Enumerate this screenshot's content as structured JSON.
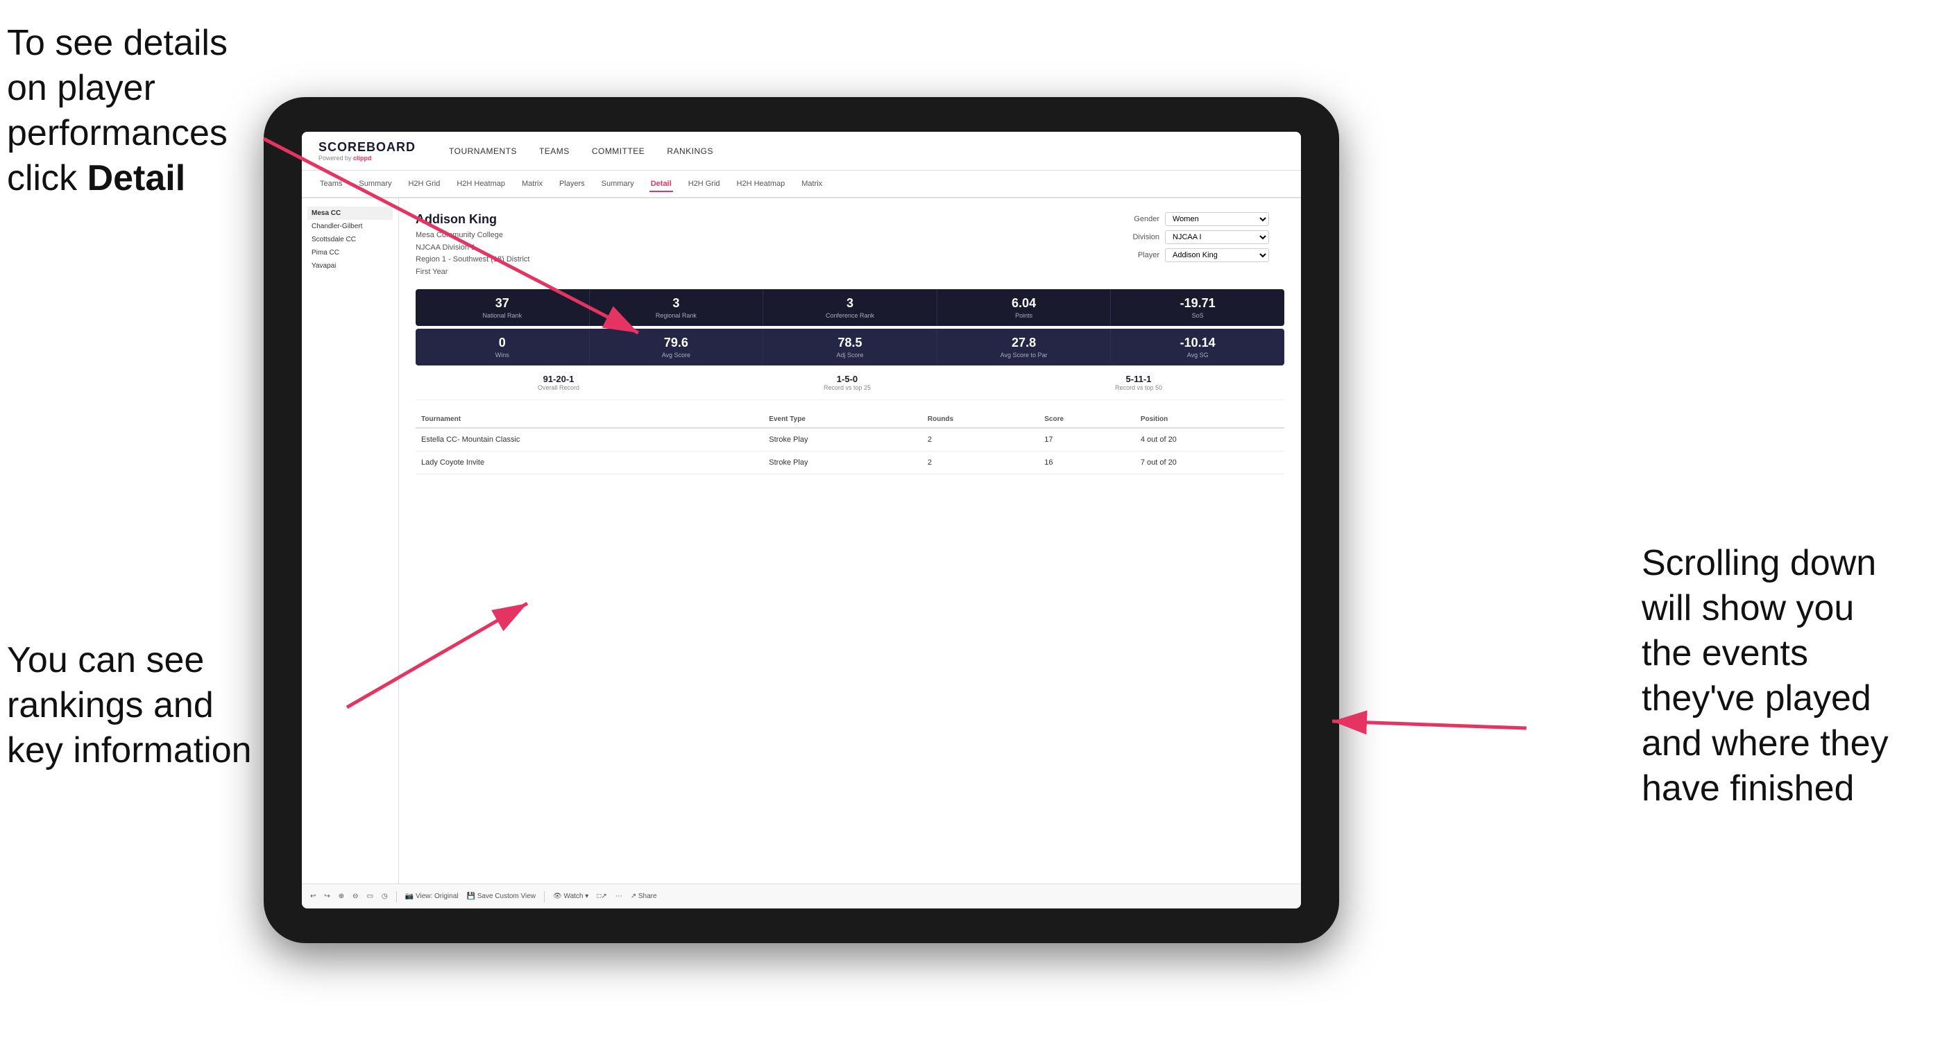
{
  "annotations": {
    "topleft": "To see details on player performances click ",
    "topleft_bold": "Detail",
    "bottomleft_line1": "You can see",
    "bottomleft_line2": "rankings and",
    "bottomleft_line3": "key information",
    "bottomright_line1": "Scrolling down",
    "bottomright_line2": "will show you",
    "bottomright_line3": "the events",
    "bottomright_line4": "they've played",
    "bottomright_line5": "and where they",
    "bottomright_line6": "have finished"
  },
  "nav": {
    "logo": "SCOREBOARD",
    "powered_by": "Powered by ",
    "clippd": "clippd",
    "items": [
      "TOURNAMENTS",
      "TEAMS",
      "COMMITTEE",
      "RANKINGS"
    ]
  },
  "subnav": {
    "items": [
      "Teams",
      "Summary",
      "H2H Grid",
      "H2H Heatmap",
      "Matrix",
      "Players",
      "Summary",
      "Detail",
      "H2H Grid",
      "H2H Heatmap",
      "Matrix"
    ],
    "active": "Detail"
  },
  "player": {
    "name": "Addison King",
    "school": "Mesa Community College",
    "division": "NJCAA Division 1",
    "region": "Region 1 - Southwest (18) District",
    "year": "First Year",
    "gender_label": "Gender",
    "gender_value": "Women",
    "division_label": "Division",
    "division_value": "NJCAA I",
    "player_label": "Player",
    "player_value": "Addison King"
  },
  "stats_row1": [
    {
      "value": "37",
      "label": "National Rank"
    },
    {
      "value": "3",
      "label": "Regional Rank"
    },
    {
      "value": "3",
      "label": "Conference Rank"
    },
    {
      "value": "6.04",
      "label": "Points"
    },
    {
      "value": "-19.71",
      "label": "SoS"
    }
  ],
  "stats_row2": [
    {
      "value": "0",
      "label": "Wins"
    },
    {
      "value": "79.6",
      "label": "Avg Score"
    },
    {
      "value": "78.5",
      "label": "Adj Score"
    },
    {
      "value": "27.8",
      "label": "Avg Score to Par"
    },
    {
      "value": "-10.14",
      "label": "Avg SG"
    }
  ],
  "records": [
    {
      "value": "91-20-1",
      "label": "Overall Record"
    },
    {
      "value": "1-5-0",
      "label": "Record vs top 25"
    },
    {
      "value": "5-11-1",
      "label": "Record vs top 50"
    }
  ],
  "table": {
    "headers": [
      "Tournament",
      "Event Type",
      "Rounds",
      "Score",
      "Position"
    ],
    "rows": [
      {
        "tournament": "Estella CC- Mountain Classic",
        "event_type": "Stroke Play",
        "rounds": "2",
        "score": "17",
        "position": "4 out of 20"
      },
      {
        "tournament": "Lady Coyote Invite",
        "event_type": "Stroke Play",
        "rounds": "2",
        "score": "16",
        "position": "7 out of 20"
      }
    ]
  },
  "toolbar": {
    "items": [
      "↩",
      "↪",
      "⊕",
      "⊕",
      "▭—",
      "◷",
      "View: Original",
      "Save Custom View",
      "Watch ▾",
      "□↗",
      "⋯",
      "Share"
    ]
  }
}
